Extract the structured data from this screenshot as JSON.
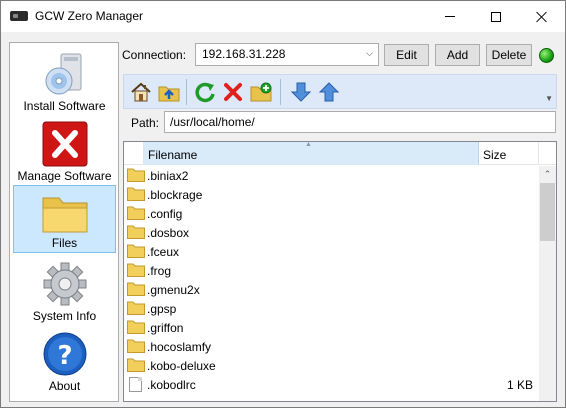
{
  "window": {
    "title": "GCW Zero Manager"
  },
  "sidebar": {
    "items": [
      {
        "label": "Install Software",
        "icon": "install-software-icon"
      },
      {
        "label": "Manage Software",
        "icon": "manage-software-icon"
      },
      {
        "label": "Files",
        "icon": "folder-icon",
        "active": true
      },
      {
        "label": "System Info",
        "icon": "gear-icon"
      },
      {
        "label": "About",
        "icon": "help-icon"
      }
    ]
  },
  "connection": {
    "label": "Connection:",
    "value": "192.168.31.228",
    "edit_label": "Edit",
    "add_label": "Add",
    "delete_label": "Delete",
    "status_color": "#17a012"
  },
  "toolbar": {
    "icons": [
      "home-icon",
      "parent-folder-icon",
      "refresh-icon",
      "delete-icon",
      "new-folder-icon",
      "download-icon",
      "upload-icon"
    ]
  },
  "path": {
    "label": "Path:",
    "value": "/usr/local/home/"
  },
  "filelist": {
    "columns": {
      "name": "Filename",
      "size": "Size"
    },
    "rows": [
      {
        "name": ".biniax2",
        "type": "folder",
        "size": ""
      },
      {
        "name": ".blockrage",
        "type": "folder",
        "size": ""
      },
      {
        "name": ".config",
        "type": "folder",
        "size": ""
      },
      {
        "name": ".dosbox",
        "type": "folder",
        "size": ""
      },
      {
        "name": ".fceux",
        "type": "folder",
        "size": ""
      },
      {
        "name": ".frog",
        "type": "folder",
        "size": ""
      },
      {
        "name": ".gmenu2x",
        "type": "folder",
        "size": ""
      },
      {
        "name": ".gpsp",
        "type": "folder",
        "size": ""
      },
      {
        "name": ".griffon",
        "type": "folder",
        "size": ""
      },
      {
        "name": ".hocoslamfy",
        "type": "folder",
        "size": ""
      },
      {
        "name": ".kobo-deluxe",
        "type": "folder",
        "size": ""
      },
      {
        "name": ".kobodlrc",
        "type": "file",
        "size": "1 KB"
      }
    ]
  }
}
